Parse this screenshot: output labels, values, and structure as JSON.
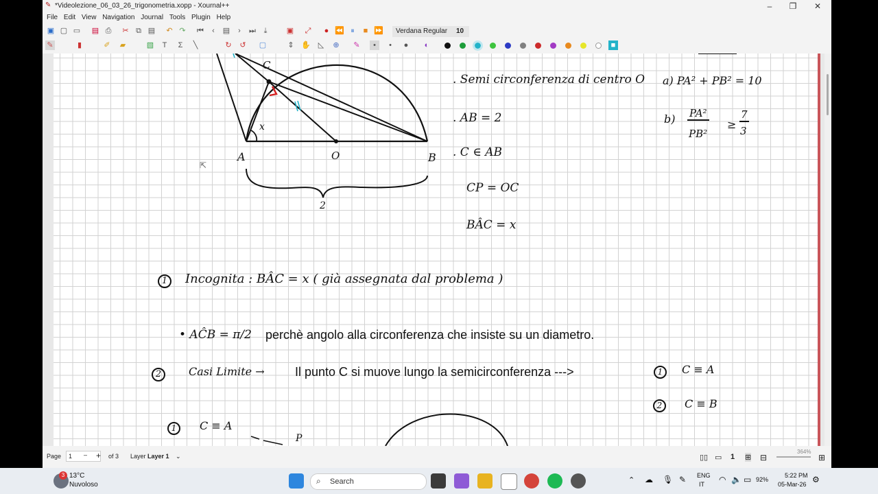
{
  "window": {
    "title": "*Videolezione_06_03_26_trigonometria.xopp - Xournal++",
    "menus": [
      "File",
      "Edit",
      "View",
      "Navigation",
      "Journal",
      "Tools",
      "Plugin",
      "Help"
    ]
  },
  "toolbar": {
    "font_name": "Verdana Regular",
    "font_size": "10",
    "pen_colors": [
      "#111111",
      "#1e9d3a",
      "#22b3c9",
      "#3ec43e",
      "#2c3bc4",
      "#808080",
      "#cc2b2b",
      "#a23bc4",
      "#e88a1e",
      "#e6e62a",
      "#ffffff"
    ]
  },
  "page": {
    "diagram_labels": {
      "A": "A",
      "O": "O",
      "B": "B",
      "C": "C",
      "x": "x",
      "two": "2"
    },
    "givens": [
      ". Semi circonferenza di centro O",
      ". AB = 2",
      ". C ∈ AB",
      "CP = OC",
      "BÂC = x"
    ],
    "conditions": {
      "a": "a)  PA² + PB² = 10",
      "b_label": "b)",
      "b_num": "PA²",
      "b_den": "PB²",
      "b_rel": "≥",
      "b_frac_num": "7",
      "b_frac_den": "3"
    },
    "step1_num": "1",
    "step1": "Incognita :   BÂC = x    ( già assegnata dal problema )",
    "angle_line_prefix": "• AĈB  =  π/2",
    "angle_line_text": "perchè angolo alla circonferenza che insiste su un diametro.",
    "step2_num": "2",
    "step2_label": "Casi Limite  →",
    "step2_text": "Il punto C si muove lungo la semicirconferenza --->",
    "case1": "C ≡ A",
    "case2": "C ≡ B",
    "case1_num": "1",
    "case2_num": "2",
    "bottom_case_num": "1",
    "bottom_case": "C ≡ A",
    "bottom_p": "P"
  },
  "statusbar": {
    "page_label": "Page",
    "page_value": "1",
    "of_pages": "of 3",
    "layer_label": "Layer",
    "layer_value": "Layer 1",
    "zoom": "364%"
  },
  "taskbar": {
    "weather_temp": "13°C",
    "weather_desc": "Nuvoloso",
    "weather_badge": "3",
    "search_placeholder": "Search",
    "lang1": "ENG",
    "lang2": "IT",
    "battery": "92%",
    "time": "5:22 PM",
    "date": "05-Mar-26"
  }
}
